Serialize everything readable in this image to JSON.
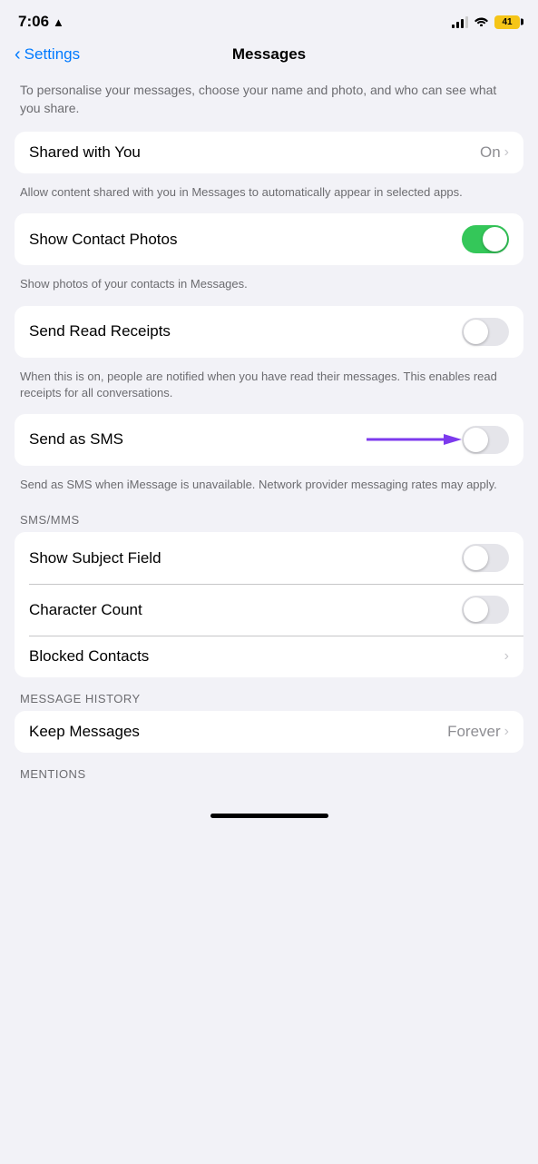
{
  "statusBar": {
    "time": "7:06",
    "locationIcon": "▲",
    "batteryLevel": "41"
  },
  "header": {
    "backLabel": "Settings",
    "title": "Messages"
  },
  "introDescription": "To personalise your messages, choose your name and photo, and who can see what you share.",
  "settings": [
    {
      "id": "shared-with-you",
      "label": "Shared with You",
      "type": "disclosure",
      "value": "On",
      "description": "Allow content shared with you in Messages to automatically appear in selected apps."
    },
    {
      "id": "show-contact-photos",
      "label": "Show Contact Photos",
      "type": "toggle",
      "toggleOn": true,
      "description": "Show photos of your contacts in Messages."
    },
    {
      "id": "send-read-receipts",
      "label": "Send Read Receipts",
      "type": "toggle",
      "toggleOn": false,
      "description": "When this is on, people are notified when you have read their messages. This enables read receipts for all conversations."
    },
    {
      "id": "send-as-sms",
      "label": "Send as SMS",
      "type": "toggle",
      "toggleOn": false,
      "hasArrow": true,
      "description": "Send as SMS when iMessage is unavailable. Network provider messaging rates may apply."
    }
  ],
  "smsMmsSection": {
    "header": "SMS/MMS",
    "items": [
      {
        "id": "show-subject-field",
        "label": "Show Subject Field",
        "type": "toggle",
        "toggleOn": false
      },
      {
        "id": "character-count",
        "label": "Character Count",
        "type": "toggle",
        "toggleOn": false
      },
      {
        "id": "blocked-contacts",
        "label": "Blocked Contacts",
        "type": "disclosure"
      }
    ]
  },
  "messageHistorySection": {
    "header": "MESSAGE HISTORY",
    "items": [
      {
        "id": "keep-messages",
        "label": "Keep Messages",
        "type": "disclosure",
        "value": "Forever"
      }
    ]
  },
  "mentionsSection": {
    "header": "MENTIONS"
  }
}
